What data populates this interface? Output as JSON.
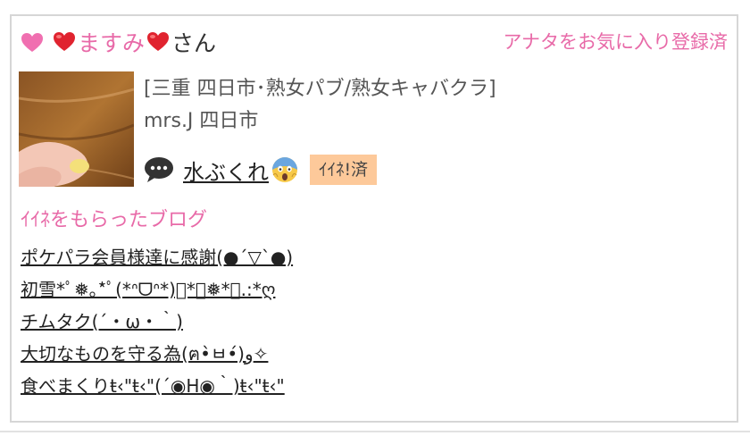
{
  "header": {
    "name": "ますみ",
    "honorific": "さん",
    "favorite_status": "アナタをお気に入り登録済"
  },
  "profile": {
    "shop": "[三重 四日市･熟女パブ/熟女キャバクラ]",
    "area": "mrs.J 四日市"
  },
  "latest_blog": {
    "title": "水ぶくれ",
    "iine_label": "ｲｲﾈ!済"
  },
  "liked_blogs": {
    "title": "ｲｲﾈをもらったブログ",
    "items": [
      "ポケパラ会員様達に感謝(●´▽`●)",
      "初雪*ﾟ❅｡*ﾟ(*ᐢᗜᐢ*)ﾟ*｡❅*｡.:*ღ",
      "チムタク(´・ω・｀)",
      "大切なものを守る為(ฅ•̀ㅂ•́)و✧",
      "食べまくりŧ‹\"ŧ‹\"(´◉H◉｀)ŧ‹\"ŧ‹\""
    ]
  },
  "colors": {
    "accent_pink": "#e86aa8",
    "heart_red": "#e0232f",
    "badge_bg": "#fdc99a"
  },
  "icons": [
    "pink-heart-icon",
    "red-heart-icon",
    "speech-bubble-icon",
    "screaming-face-icon"
  ]
}
